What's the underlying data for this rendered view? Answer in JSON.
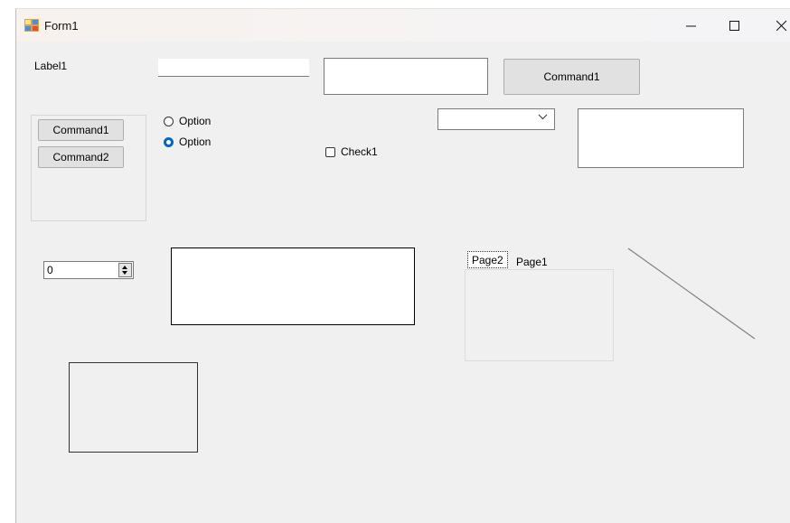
{
  "window": {
    "title": "Form1",
    "controls": {
      "minimize": "minimize",
      "maximize": "maximize",
      "close": "close"
    }
  },
  "form": {
    "label1": "Label1",
    "textbox_small_value": "",
    "textbox_medium_value": "",
    "command_top": "Command1",
    "frame_buttons": [
      "Command1",
      "Command2"
    ],
    "options": [
      {
        "label": "Option",
        "selected": false
      },
      {
        "label": "Option",
        "selected": true
      }
    ],
    "checkbox": {
      "label": "Check1",
      "checked": false
    },
    "combo_value": "",
    "spin_value": "0",
    "tabs": [
      {
        "label": "Page2",
        "selected": true
      },
      {
        "label": "Page1",
        "selected": false
      }
    ]
  },
  "colors": {
    "accent": "#0067c0",
    "client_bg": "#f0f0f0",
    "line": "#808080"
  }
}
